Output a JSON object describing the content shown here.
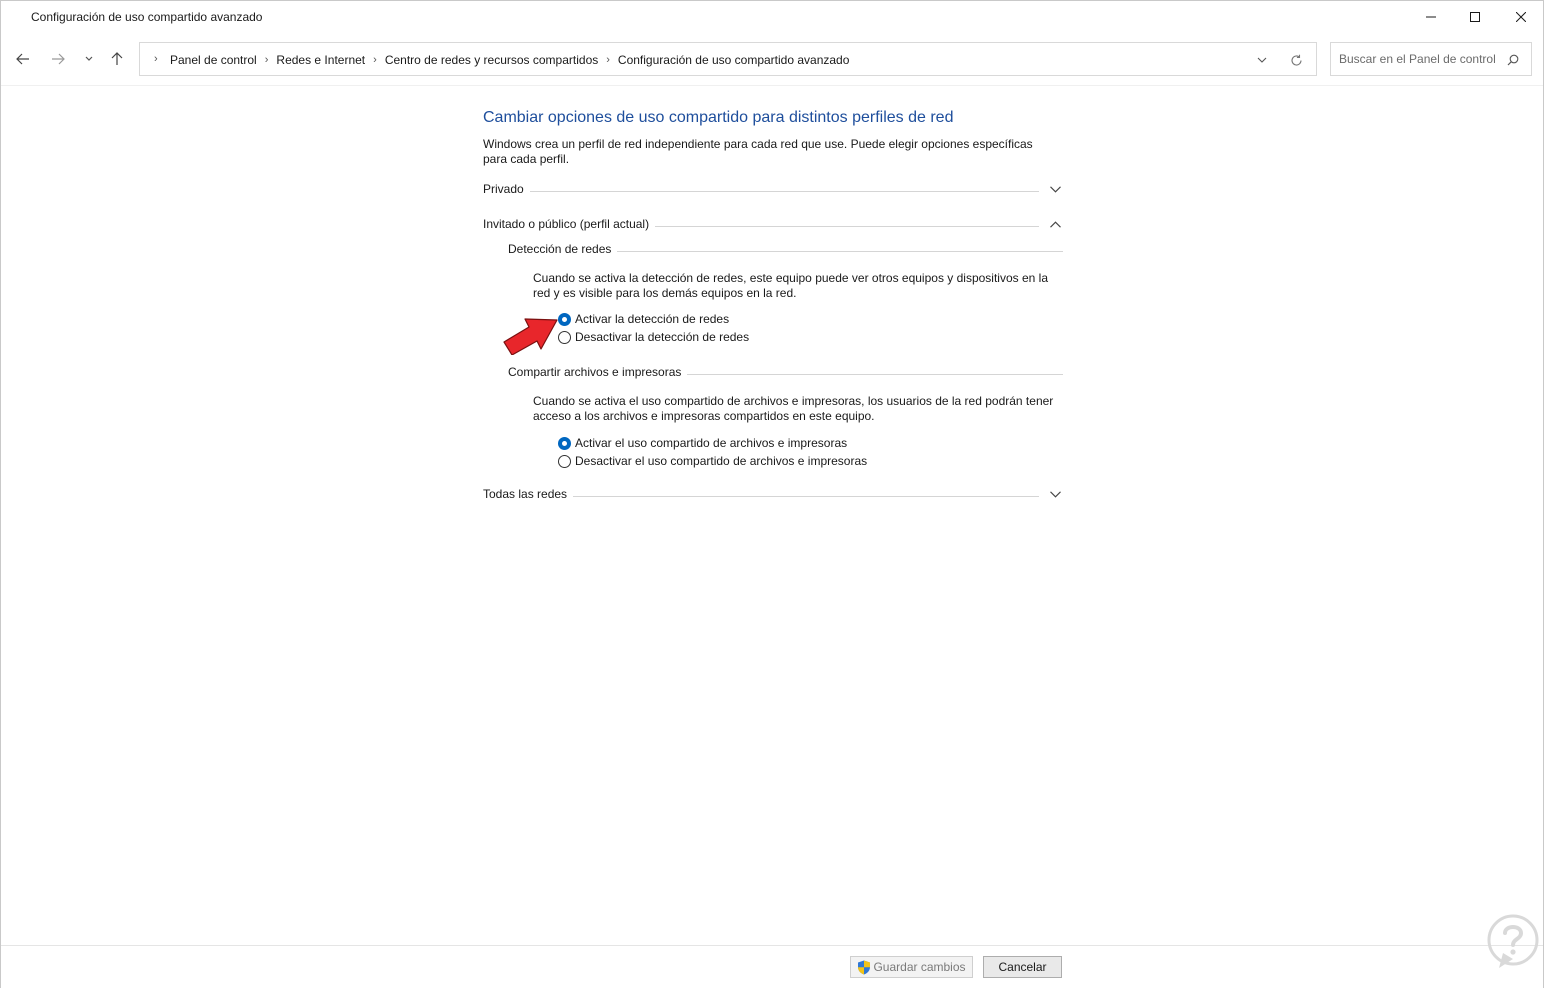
{
  "window": {
    "title": "Configuración de uso compartido avanzado",
    "controls": {
      "minimize": "minimize-icon",
      "maximize": "maximize-icon",
      "close": "close-icon"
    }
  },
  "nav": {
    "back_icon": "arrow-left-icon",
    "forward_icon": "arrow-right-icon",
    "recent_icon": "chevron-down-icon",
    "up_icon": "arrow-up-icon",
    "breadcrumbs": [
      "Panel de control",
      "Redes e Internet",
      "Centro de redes y recursos compartidos",
      "Configuración de uso compartido avanzado"
    ],
    "search_placeholder": "Buscar en el Panel de control"
  },
  "page": {
    "title": "Cambiar opciones de uso compartido para distintos perfiles de red",
    "description": "Windows crea un perfil de red independiente para cada red que use. Puede elegir opciones específicas para cada perfil.",
    "profiles": {
      "private": {
        "label": "Privado",
        "expanded": false
      },
      "guest": {
        "label": "Invitado o público (perfil actual)",
        "expanded": true
      },
      "all": {
        "label": "Todas las redes",
        "expanded": false
      }
    },
    "network_discovery": {
      "label": "Detección de redes",
      "description": "Cuando se activa la detección de redes, este equipo puede ver otros equipos y dispositivos en la red y es visible para los demás equipos en la red.",
      "options": [
        {
          "label": "Activar la detección de redes",
          "checked": true
        },
        {
          "label": "Desactivar la detección de redes",
          "checked": false
        }
      ]
    },
    "file_sharing": {
      "label": "Compartir archivos e impresoras",
      "description": "Cuando se activa el uso compartido de archivos e impresoras, los usuarios de la red podrán tener acceso a los archivos e impresoras compartidos en este equipo.",
      "options": [
        {
          "label": "Activar el uso compartido de archivos e impresoras",
          "checked": true
        },
        {
          "label": "Desactivar el uso compartido de archivos e impresoras",
          "checked": false
        }
      ]
    }
  },
  "footer": {
    "save_label": "Guardar cambios",
    "save_enabled": false,
    "cancel_label": "Cancelar"
  },
  "colors": {
    "title_blue": "#1e4e9c",
    "radio_blue": "#0067c0",
    "arrow_red": "#e8262b"
  }
}
